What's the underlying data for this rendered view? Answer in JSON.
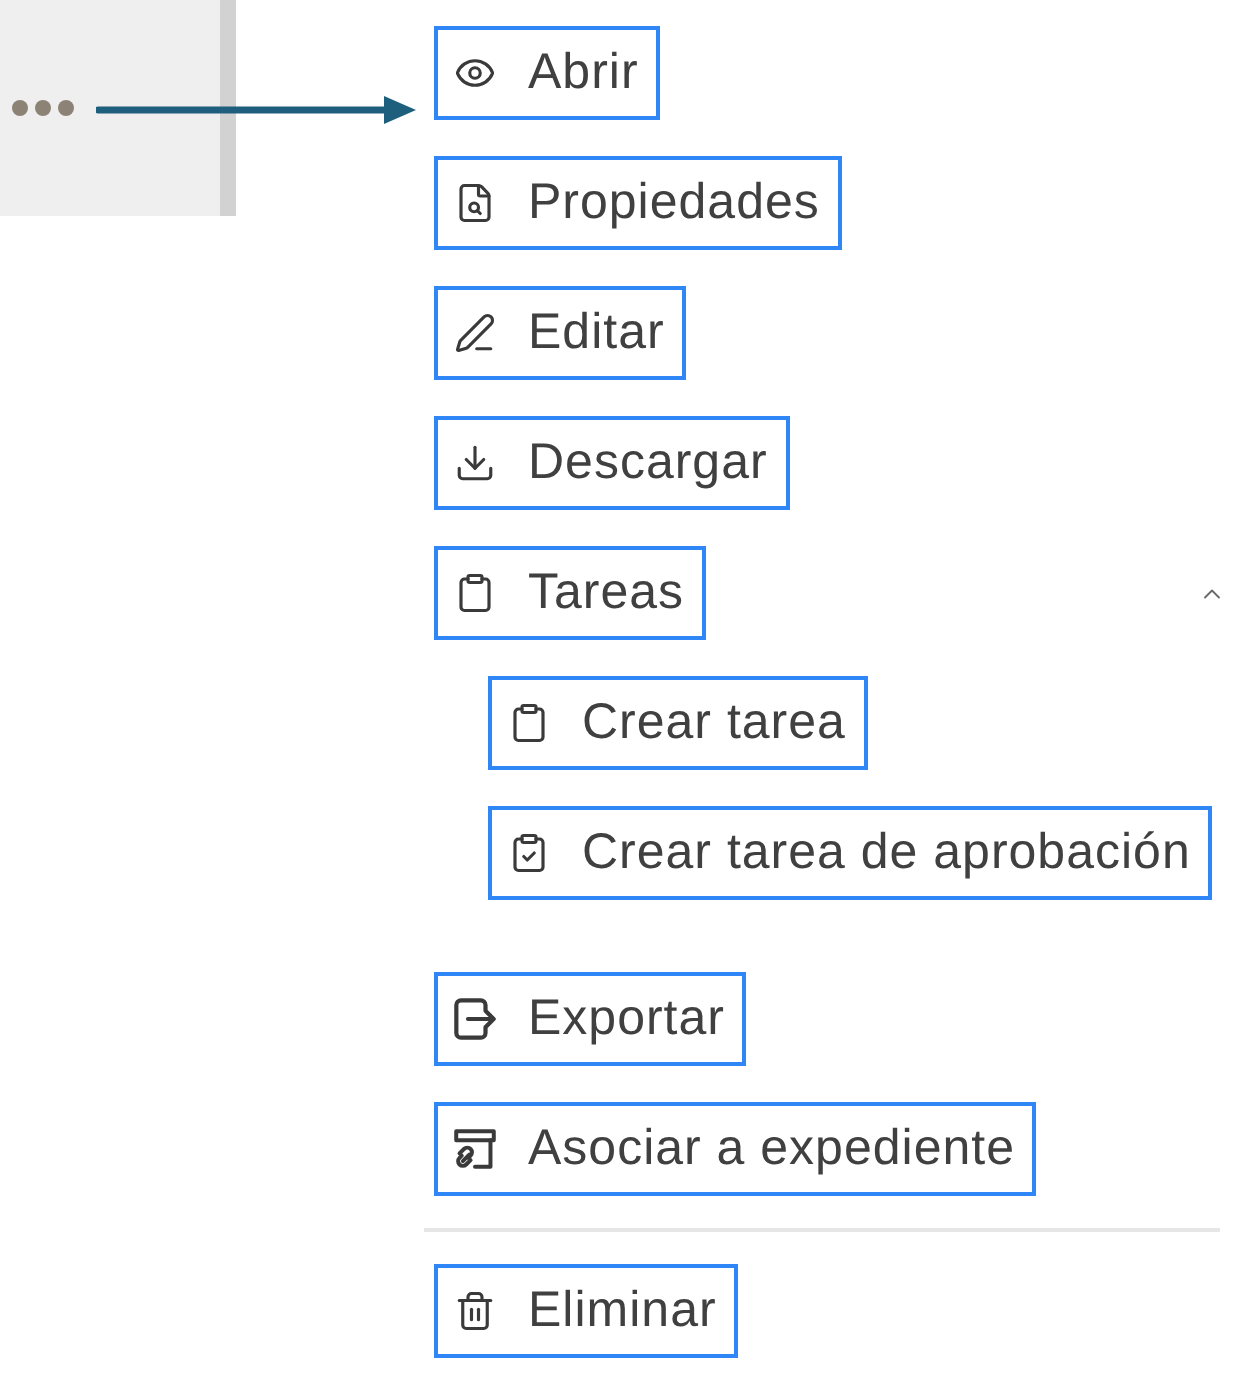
{
  "menu": {
    "sections": [
      {
        "items": [
          {
            "label": "Abrir"
          },
          {
            "label": "Propiedades"
          },
          {
            "label": "Editar"
          },
          {
            "label": "Descargar"
          },
          {
            "label": "Tareas",
            "expanded": true,
            "children": [
              {
                "label": "Crear tarea"
              },
              {
                "label": "Crear tarea de aprobación"
              }
            ]
          },
          {
            "label": "Exportar"
          },
          {
            "label": "Asociar a expediente"
          }
        ]
      },
      {
        "items": [
          {
            "label": "Eliminar"
          }
        ]
      }
    ]
  }
}
